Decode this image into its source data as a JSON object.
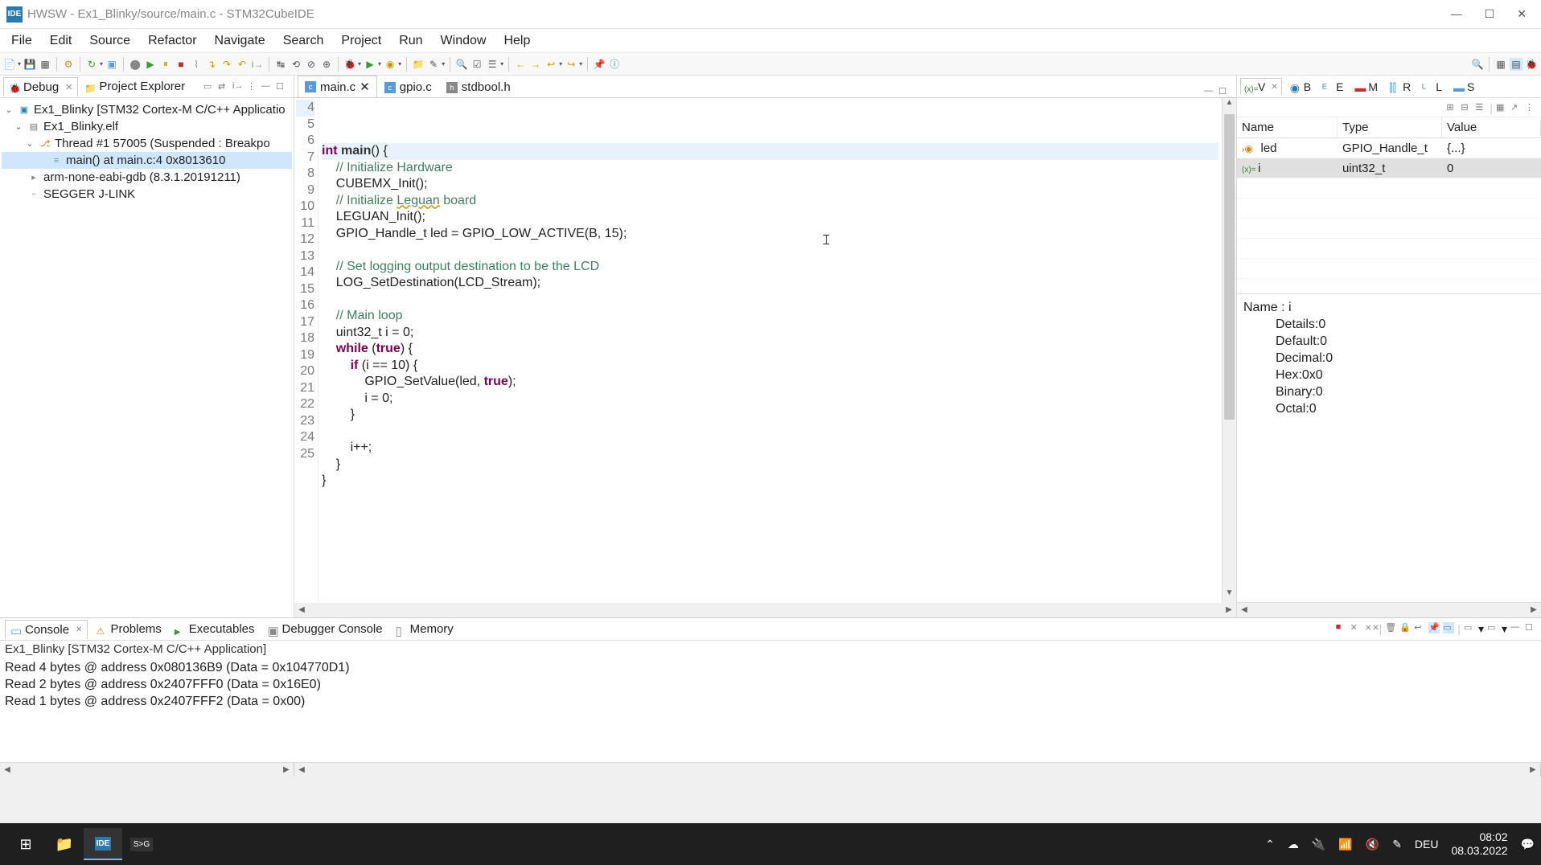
{
  "window": {
    "app_icon_text": "IDE",
    "title": "HWSW - Ex1_Blinky/source/main.c - STM32CubeIDE"
  },
  "menu": [
    "File",
    "Edit",
    "Source",
    "Refactor",
    "Navigate",
    "Search",
    "Project",
    "Run",
    "Window",
    "Help"
  ],
  "left_panel": {
    "tabs": {
      "debug": "Debug",
      "project_explorer": "Project Explorer"
    },
    "tree": {
      "root": "Ex1_Blinky [STM32 Cortex-M C/C++ Applicatio",
      "elf": "Ex1_Blinky.elf",
      "thread": "Thread #1 57005 (Suspended : Breakpo",
      "frame": "main() at main.c:4 0x8013610",
      "gdb": "arm-none-eabi-gdb (8.3.1.20191211)",
      "jlink": "SEGGER J-LINK"
    }
  },
  "editor": {
    "tabs": {
      "main": "main.c",
      "gpio": "gpio.c",
      "stdbool": "stdbool.h"
    },
    "lines": [
      {
        "n": 4,
        "html": "<span class='kw'>int</span> <span class='fn'><b>main</b></span>() {",
        "hl": true,
        "fold": true
      },
      {
        "n": 5,
        "html": "    <span class='cm'>// Initialize Hardware</span>"
      },
      {
        "n": 6,
        "html": "    CUBEMX_Init();"
      },
      {
        "n": 7,
        "html": "    <span class='cm'>// Initialize <span class='err-squiggle'>Leguan</span> board</span>"
      },
      {
        "n": 8,
        "html": "    LEGUAN_Init();"
      },
      {
        "n": 9,
        "html": "    GPIO_Handle_t led = GPIO_LOW_ACTIVE(B, 15);"
      },
      {
        "n": 10,
        "html": ""
      },
      {
        "n": 11,
        "html": "    <span class='cm'>// Set logging output destination to be the LCD</span>"
      },
      {
        "n": 12,
        "html": "    LOG_SetDestination(LCD_Stream);"
      },
      {
        "n": 13,
        "html": ""
      },
      {
        "n": 14,
        "html": "    <span class='cm'>// Main loop</span>"
      },
      {
        "n": 15,
        "html": "    uint32_t i = 0;"
      },
      {
        "n": 16,
        "html": "    <span class='kw'>while</span> (<span class='kw'>true</span>) {"
      },
      {
        "n": 17,
        "html": "        <span class='kw'>if</span> (i == 10) {",
        "bp": true
      },
      {
        "n": 18,
        "html": "            GPIO_SetValue(led, <span class='kw'>true</span>);"
      },
      {
        "n": 19,
        "html": "            i = 0;"
      },
      {
        "n": 20,
        "html": "        }"
      },
      {
        "n": 21,
        "html": ""
      },
      {
        "n": 22,
        "html": "        i++;"
      },
      {
        "n": 23,
        "html": "    }"
      },
      {
        "n": 24,
        "html": "}"
      },
      {
        "n": 25,
        "html": ""
      }
    ]
  },
  "right_panel": {
    "tabs": {
      "v": "V",
      "b": "B",
      "e": "E",
      "m": "M",
      "r": "R",
      "l": "L",
      "s": "S"
    },
    "columns": {
      "name": "Name",
      "type": "Type",
      "value": "Value"
    },
    "rows": [
      {
        "name": "led",
        "type": "GPIO_Handle_t",
        "value": "{...}",
        "icon": "struct",
        "expandable": true
      },
      {
        "name": "i",
        "type": "uint32_t",
        "value": "0",
        "icon": "var",
        "selected": true
      }
    ],
    "detail": {
      "header": "Name : i",
      "lines": [
        "Details:0",
        "Default:0",
        "Decimal:0",
        "Hex:0x0",
        "Binary:0",
        "Octal:0"
      ]
    }
  },
  "console": {
    "tabs": {
      "console": "Console",
      "problems": "Problems",
      "executables": "Executables",
      "debugger_console": "Debugger Console",
      "memory": "Memory"
    },
    "subtitle": "Ex1_Blinky [STM32 Cortex-M C/C++ Application]",
    "lines": [
      "Read 4 bytes @ address 0x080136B9 (Data = 0x104770D1)",
      "Read 2 bytes @ address 0x2407FFF0 (Data = 0x16E0)",
      "Read 1 bytes @ address 0x2407FFF2 (Data = 0x00)"
    ]
  },
  "taskbar": {
    "lang": "DEU",
    "time": "08:02",
    "date": "08.03.2022"
  }
}
